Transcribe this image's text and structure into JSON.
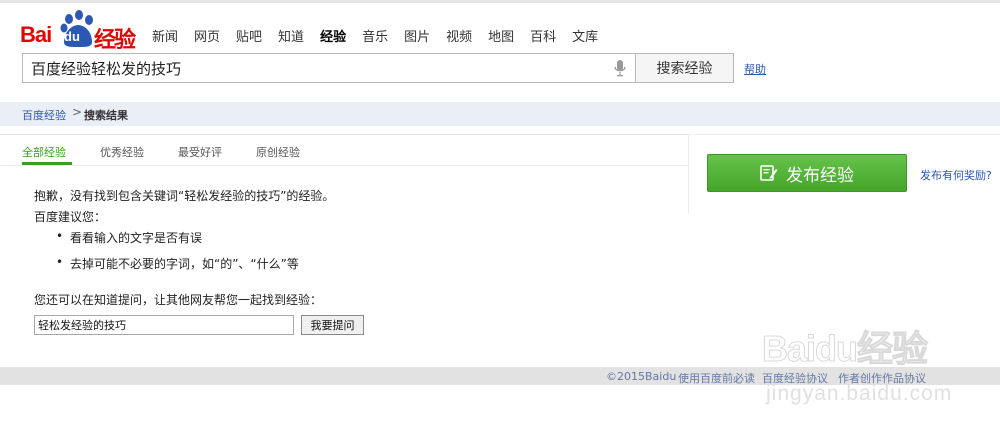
{
  "header": {
    "logo_bai": "Bai",
    "logo_du": "du",
    "logo_jingyan": "经验",
    "nav": [
      "新闻",
      "网页",
      "贴吧",
      "知道",
      "经验",
      "音乐",
      "图片",
      "视频",
      "地图",
      "百科",
      "文库"
    ],
    "nav_active": "经验",
    "search_value": "百度经验轻松发的技巧",
    "search_button": "搜索经验",
    "help_link": "帮助"
  },
  "breadcrumb": {
    "home": "百度经验",
    "separator": ">",
    "current": "搜索结果"
  },
  "tabs": [
    "全部经验",
    "优秀经验",
    "最受好评",
    "原创经验"
  ],
  "result": {
    "sorry": "抱歉，没有找到包含关键词“轻松发经验的技巧”的经验。",
    "suggest_title": "百度建议您：",
    "tips": [
      "看看输入的文字是否有误",
      "去掉可能不必要的字词，如“的”、“什么”等"
    ],
    "ask_text": "您还可以在知道提问，让其他网友帮您一起找到经验：",
    "ask_input_value": "轻松发经验的技巧",
    "ask_button": "我要提问"
  },
  "sidebar": {
    "publish_button": "发布经验",
    "reward_link": "发布有何奖励?"
  },
  "footer": {
    "copyright": "©2015Baidu",
    "terms": "使用百度前必读",
    "link3": "百度经验协议",
    "link4": "作者创作作品协议"
  },
  "watermark": {
    "brand": "Baidu经验",
    "url": "jingyan.baidu.com"
  },
  "colors": {
    "brand_red": "#e10602",
    "brand_blue": "#2b57b5",
    "accent_green": "#38a019",
    "publish_green": "#52b136"
  }
}
